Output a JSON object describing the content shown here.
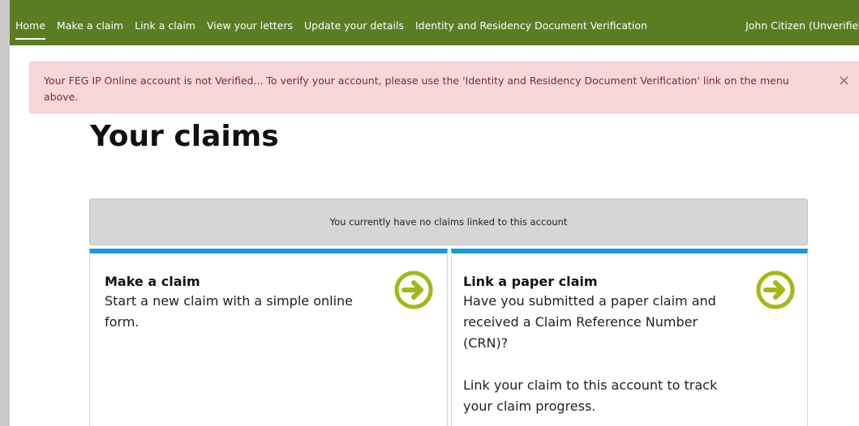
{
  "nav": {
    "items": [
      {
        "label": "Home",
        "active": true
      },
      {
        "label": "Make a claim"
      },
      {
        "label": "Link a claim"
      },
      {
        "label": "View your letters"
      },
      {
        "label": "Update your details"
      },
      {
        "label": "Identity and Residency Document Verification"
      }
    ],
    "user": "John Citizen (Unverified)"
  },
  "alert": {
    "text": "Your FEG IP Online account is not Verified... To verify your account, please use the 'Identity and Residency Document Verification' link on the menu above.",
    "close": "×"
  },
  "page": {
    "title": "Your claims",
    "no_claims": "You currently have no claims linked to this account"
  },
  "cards": [
    {
      "title": "Make a claim",
      "text": "Start a new claim with a simple online form.",
      "icon": "arrow-right-circle-icon"
    },
    {
      "title": "Link a paper claim",
      "text": "Have you submitted a paper claim and received a Claim Reference Number (CRN)?",
      "text2": "Link your claim to this account to track your claim progress.",
      "icon": "arrow-right-circle-icon"
    }
  ],
  "colors": {
    "navbar": "#5a7d24",
    "alert_bg": "#f8d7da",
    "card_accent": "#1a9bd7",
    "arrow": "#a3b817"
  }
}
